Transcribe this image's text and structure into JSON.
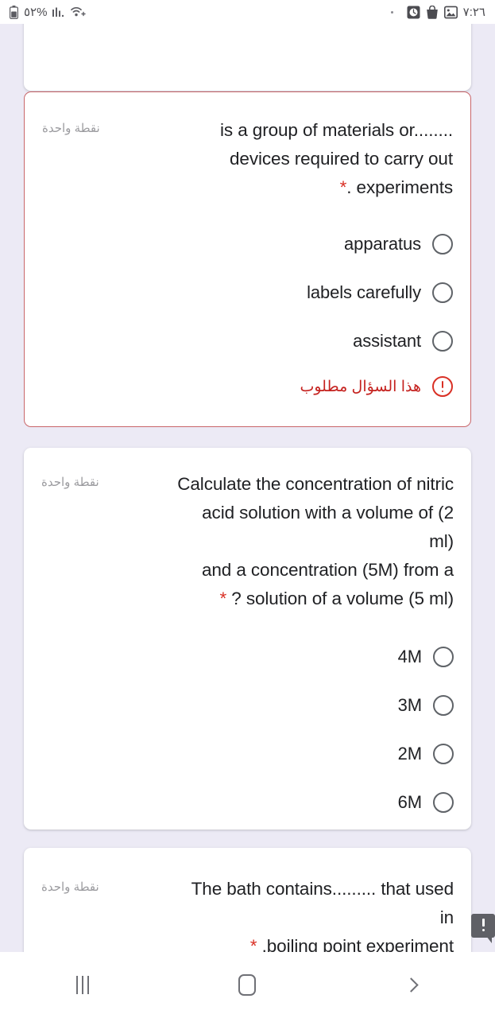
{
  "status_bar": {
    "battery_percent": "٥٢%",
    "time": "٧:٢٦",
    "icons_left": [
      "battery-icon",
      "signal-bars-icon",
      "wifi-icon"
    ],
    "icons_right": [
      "dot-icon",
      "clock-icon",
      "shopping-bag-icon",
      "gallery-icon"
    ]
  },
  "form": {
    "background_color": "#eceaf5",
    "error_color": "#d93025",
    "points_label": "نقطة واحدة",
    "required_marker": "*",
    "questions": [
      {
        "id": "q-partial",
        "text": "",
        "points": "",
        "options": [],
        "has_error": false
      },
      {
        "id": "q-apparatus",
        "points": "نقطة واحدة",
        "line1": "is a group of materials or........",
        "line2": "devices required to carry out",
        "line3": ". experiments",
        "required": "*",
        "options": [
          {
            "label": "apparatus",
            "selected": false
          },
          {
            "label": "labels carefully",
            "selected": false
          },
          {
            "label": "assistant",
            "selected": false
          }
        ],
        "has_error": true,
        "error_text": "هذا السؤال مطلوب"
      },
      {
        "id": "q-concentration",
        "points": "نقطة واحدة",
        "line1": "Calculate the concentration of nitric",
        "line2": "acid solution with a volume of (2 ml)",
        "line3": "and a concentration (5M) from a",
        "line4": "? solution of a volume (5 ml)",
        "required": "*",
        "options": [
          {
            "label": "4M",
            "selected": false
          },
          {
            "label": "3M",
            "selected": false
          },
          {
            "label": "2M",
            "selected": false
          },
          {
            "label": "6M",
            "selected": false
          }
        ],
        "has_error": false
      },
      {
        "id": "q-bath",
        "points": "نقطة واحدة",
        "line1": "The bath contains......... that used in",
        "line2": ".boiling point experiment",
        "required": "*",
        "options": [],
        "has_error": false
      }
    ]
  },
  "nav_bar": {
    "recents_label": "recents-icon",
    "home_label": "home-icon",
    "back_label": "back-icon"
  }
}
